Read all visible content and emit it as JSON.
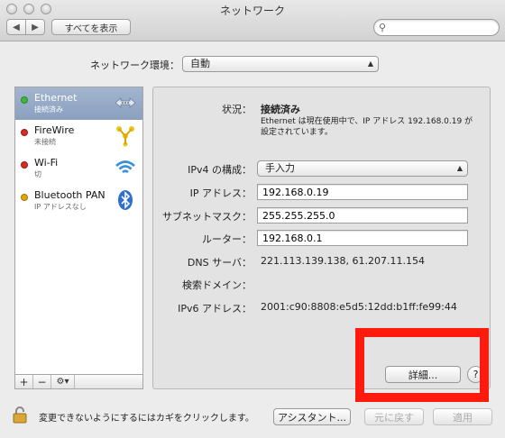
{
  "window": {
    "title": "ネットワーク",
    "show_all": "すべてを表示",
    "search_placeholder": "",
    "nav_back": "◀",
    "nav_forward": "▶"
  },
  "location": {
    "label": "ネットワーク環境：",
    "value": "自動"
  },
  "services": [
    {
      "name": "Ethernet",
      "status": "接続済み",
      "color": "#3fb53a",
      "icon": "ethernet-arrows-icon",
      "selected": true
    },
    {
      "name": "FireWire",
      "status": "未接続",
      "color": "#d52c25",
      "icon": "firewire-icon",
      "selected": false
    },
    {
      "name": "Wi-Fi",
      "status": "切",
      "color": "#d52c25",
      "icon": "wifi-icon",
      "selected": false
    },
    {
      "name": "Bluetooth PAN",
      "status": "IP アドレスなし",
      "color": "#e3a20f",
      "icon": "bluetooth-icon",
      "selected": false
    }
  ],
  "sidebar_buttons": {
    "add": "+",
    "remove": "−",
    "action": "⚙▾"
  },
  "detail": {
    "status_label": "状況：",
    "status_value": "接続済み",
    "status_desc": "Ethernet は現在使用中で、IP アドレス 192.168.0.19 が設定されています。",
    "ipv4_config_label": "IPv4 の構成：",
    "ipv4_config_value": "手入力",
    "ip_label": "IP アドレス：",
    "ip_value": "192.168.0.19",
    "subnet_label": "サブネットマスク：",
    "subnet_value": "255.255.255.0",
    "router_label": "ルーター：",
    "router_value": "192.168.0.1",
    "dns_label": "DNS サーバ：",
    "dns_value": "221.113.139.138, 61.207.11.154",
    "search_domain_label": "検索ドメイン：",
    "search_domain_value": "",
    "ipv6_label": "IPv6 アドレス：",
    "ipv6_value": "2001:c90:8808:e5d5:12dd:b1ff:fe99:44",
    "advanced_button": "詳細...",
    "help_button": "?"
  },
  "footer": {
    "lock_text": "変更できないようにするにはカギをクリックします。",
    "assistant_button": "アシスタント...",
    "revert_button": "元に戻す",
    "apply_button": "適用"
  },
  "colors": {
    "highlight": "#ff1a0e",
    "selection": "#8aa0bf"
  }
}
